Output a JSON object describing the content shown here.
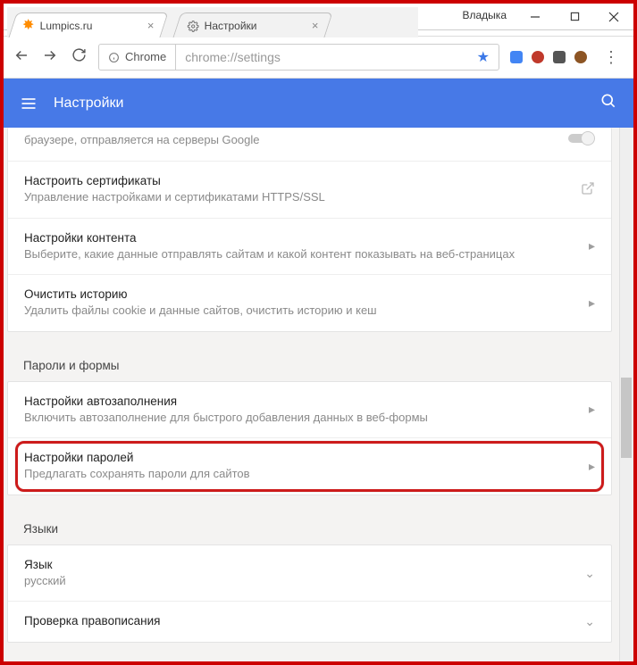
{
  "window": {
    "user_label": "Владыка"
  },
  "tabs": [
    {
      "title": "Lumpics.ru",
      "active": true
    },
    {
      "title": "Настройки",
      "active": false
    }
  ],
  "omnibox": {
    "source_label": "Chrome",
    "url": "chrome://settings"
  },
  "header": {
    "title": "Настройки"
  },
  "group1": {
    "item0_sub": "браузере, отправляется на серверы Google",
    "item1_title": "Настроить сертификаты",
    "item1_sub": "Управление настройками и сертификатами HTTPS/SSL",
    "item2_title": "Настройки контента",
    "item2_sub": "Выберите, какие данные отправлять сайтам и какой контент показывать на веб-страницах",
    "item3_title": "Очистить историю",
    "item3_sub": "Удалить файлы cookie и данные сайтов, очистить историю и кеш"
  },
  "section_passwords": {
    "label": "Пароли и формы",
    "item0_title": "Настройки автозаполнения",
    "item0_sub": "Включить автозаполнение для быстрого добавления данных в веб-формы",
    "item1_title": "Настройки паролей",
    "item1_sub": "Предлагать сохранять пароли для сайтов"
  },
  "section_languages": {
    "label": "Языки",
    "item0_title": "Язык",
    "item0_sub": "русский",
    "item1_title": "Проверка правописания"
  }
}
